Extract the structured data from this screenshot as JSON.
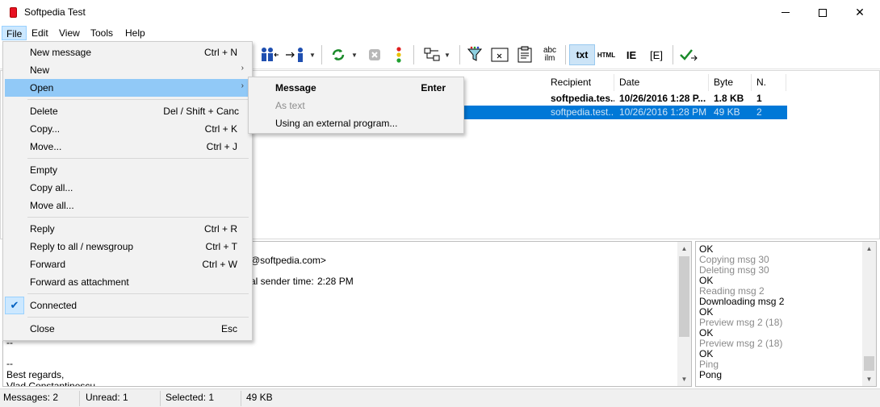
{
  "window": {
    "title": "Softpedia Test",
    "icon": "red-square-app-icon"
  },
  "menubar": {
    "items": [
      "File",
      "Edit",
      "View",
      "Tools",
      "Help"
    ]
  },
  "toolbar": {
    "buttons": [
      {
        "name": "participants-icon"
      },
      {
        "name": "send-to-icon"
      },
      {
        "name": "refresh-icon"
      },
      {
        "name": "stop-icon"
      },
      {
        "name": "traffic-light-icon"
      },
      {
        "name": "tree-layout-icon"
      },
      {
        "name": "filter-icon"
      },
      {
        "name": "clear-icon"
      },
      {
        "name": "properties-icon"
      },
      {
        "name": "spellcheck-icon",
        "label_top": "abc",
        "label_bottom": "ilm"
      },
      {
        "name": "txt-view-button",
        "label": "txt",
        "pressed": true
      },
      {
        "name": "html-view-button",
        "label": "HTML"
      },
      {
        "name": "ie-view-button",
        "label": "IE"
      },
      {
        "name": "source-view-button",
        "label": "[E]"
      },
      {
        "name": "check-send-icon"
      }
    ]
  },
  "message_list": {
    "columns": [
      "Recipient",
      "Date",
      "Byte",
      "N."
    ],
    "rows": [
      {
        "recipient": "softpedia.tes...",
        "date": "10/26/2016 1:28 P...",
        "byte": "1.8 KB",
        "n": "1",
        "bold": true
      },
      {
        "recipient": "softpedia.test...",
        "date": "10/26/2016 1:28 PM",
        "byte": "49 KB",
        "n": "2",
        "selected": true
      }
    ]
  },
  "preview": {
    "lines": [
      "@softpedia.com>",
      "al sender time:",
      "2:28 PM",
      "--",
      "--",
      "Best regards,",
      "Vlad Constantinescu"
    ]
  },
  "log": {
    "lines": [
      {
        "text": "OK",
        "dim": false
      },
      {
        "text": "Copying msg 30",
        "dim": true
      },
      {
        "text": "Deleting msg 30",
        "dim": true
      },
      {
        "text": "OK",
        "dim": false
      },
      {
        "text": "Reading msg 2",
        "dim": true
      },
      {
        "text": "Downloading msg 2",
        "dim": false
      },
      {
        "text": "OK",
        "dim": false
      },
      {
        "text": "Preview msg 2 (18)",
        "dim": true
      },
      {
        "text": "OK",
        "dim": false
      },
      {
        "text": "Preview msg 2 (18)",
        "dim": true
      },
      {
        "text": "OK",
        "dim": false
      },
      {
        "text": "Ping",
        "dim": true
      },
      {
        "text": "Pong",
        "dim": false
      }
    ]
  },
  "file_menu": {
    "items": [
      {
        "label": "New message",
        "shortcut": "Ctrl + N"
      },
      {
        "label": "New",
        "submenu": true
      },
      {
        "label": "Open",
        "submenu": true,
        "highlighted": true
      },
      {
        "label": "Delete",
        "shortcut": "Del / Shift + Canc"
      },
      {
        "label": "Copy...",
        "shortcut": "Ctrl + K"
      },
      {
        "label": "Move...",
        "shortcut": "Ctrl + J"
      },
      {
        "label": "Empty"
      },
      {
        "label": "Copy all..."
      },
      {
        "label": "Move all..."
      },
      {
        "label": "Reply",
        "shortcut": "Ctrl + R"
      },
      {
        "label": "Reply to all / newsgroup",
        "shortcut": "Ctrl + T"
      },
      {
        "label": "Forward",
        "shortcut": "Ctrl + W"
      },
      {
        "label": "Forward as attachment"
      },
      {
        "label": "Connected",
        "checked": true
      },
      {
        "label": "Close",
        "shortcut": "Esc"
      }
    ]
  },
  "open_submenu": {
    "items": [
      {
        "label": "Message",
        "shortcut": "Enter",
        "bold": true
      },
      {
        "label": "As text",
        "disabled": true
      },
      {
        "label": "Using an external program..."
      }
    ]
  },
  "statusbar": {
    "messages": "Messages: 2",
    "unread": "Unread: 1",
    "selected": "Selected: 1",
    "size": "49 KB"
  },
  "colors": {
    "selection": "#0078d7",
    "menu_highlight": "#91c9f7",
    "menu_bg": "#f2f2f2",
    "close_red": "#e81123"
  }
}
